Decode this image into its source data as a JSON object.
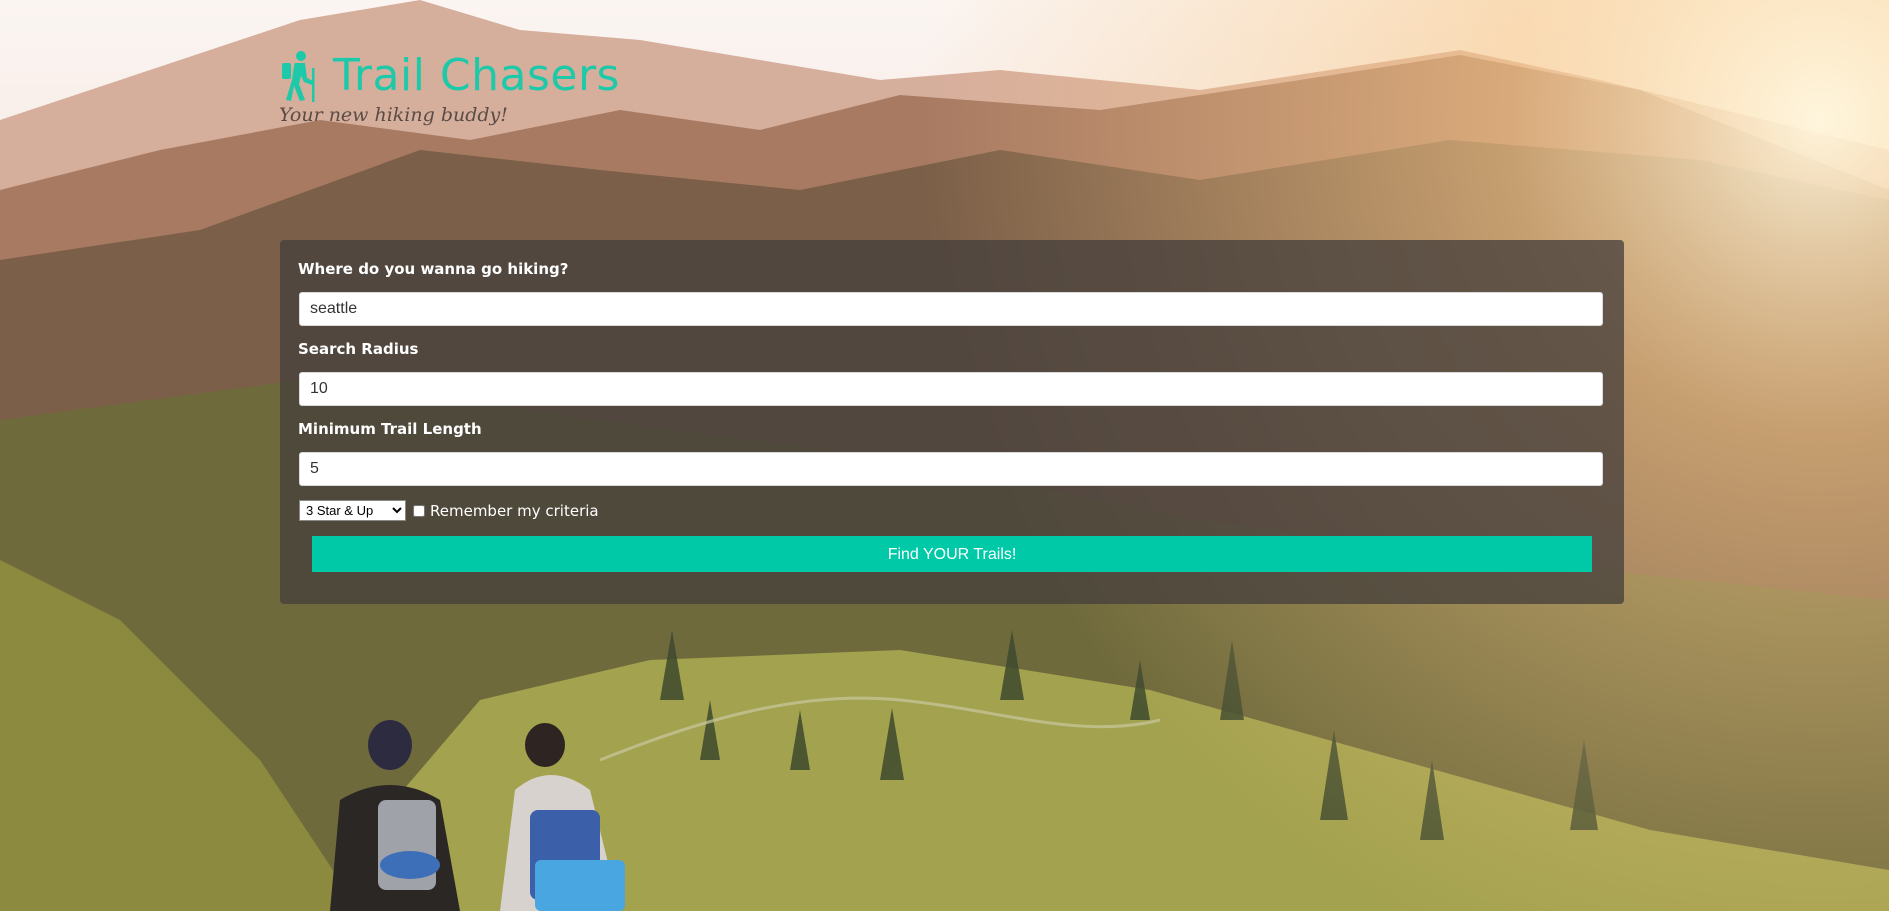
{
  "brand": {
    "title": "Trail Chasers",
    "subtitle": "Your new hiking buddy!",
    "accent_color": "#1ec9a9",
    "icon": "hiker-icon"
  },
  "form": {
    "location": {
      "label": "Where do you wanna go hiking?",
      "value": "seattle"
    },
    "radius": {
      "label": "Search Radius",
      "value": "10"
    },
    "min_length": {
      "label": "Minimum Trail Length",
      "value": "5"
    },
    "rating": {
      "selected": "3 Star & Up"
    },
    "remember": {
      "label": "Remember my criteria",
      "checked": false
    },
    "submit_label": "Find YOUR Trails!",
    "button_color": "#00c9a7"
  }
}
